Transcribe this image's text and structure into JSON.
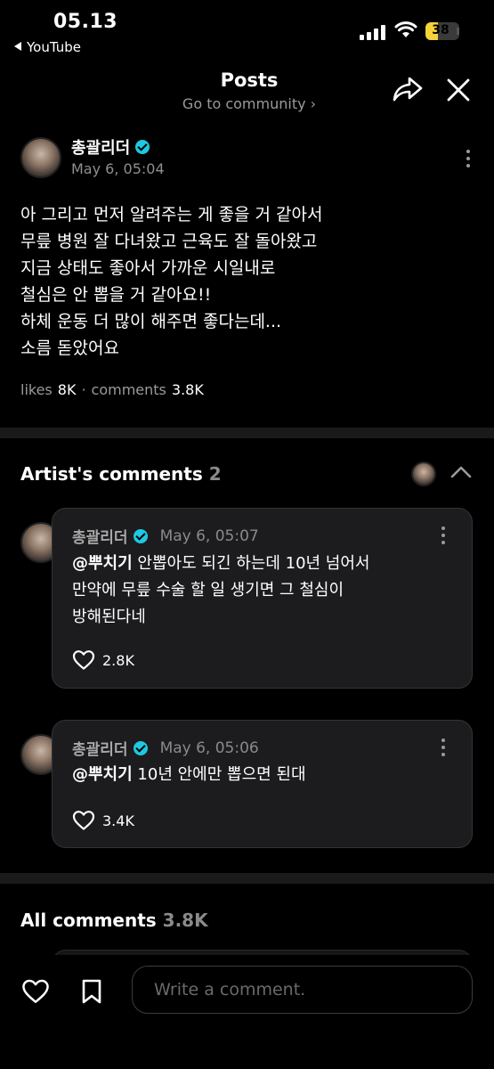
{
  "status_bar": {
    "time": "05.13",
    "back_app": "YouTube",
    "battery": "38",
    "battery_level": 0.38
  },
  "header": {
    "title": "Posts",
    "subtitle": "Go to community ›"
  },
  "post": {
    "author": "총괄리더",
    "date": "May 6, 05:04",
    "lines": [
      "아 그리고 먼저 알려주는 게 좋을 거 같아서",
      "무릎 병원 잘 다녀왔고 근육도 잘 돌아왔고",
      "지금 상태도 좋아서 가까운 시일내로",
      "철심은 안 뽑을 거 같아요!!",
      "하체 운동 더 많이 해주면 좋다는데...",
      "소름 돋았어요"
    ],
    "likes_label": "likes",
    "likes": "8K",
    "separator": "·",
    "comments_label": "comments",
    "comments": "3.8K"
  },
  "artist_comments": {
    "title": "Artist's comments",
    "count": "2",
    "items": [
      {
        "author": "총괄리더",
        "time": "May 6, 05:07",
        "mention": "@뿌치기",
        "lines": [
          "안뽑아도 되긴 하는데 10년 넘어서",
          "만약에 무릎 수술 할 일 생기면 그 철심이",
          "방해된다네"
        ],
        "likes": "2.8K"
      },
      {
        "author": "총괄리더",
        "time": "May 6, 05:06",
        "mention": "@뿌치기",
        "lines": [
          "10년 안에만 뽑으면 된대"
        ],
        "likes": "3.4K"
      }
    ]
  },
  "all_comments": {
    "title": "All comments",
    "count": "3.8K"
  },
  "bottom_bar": {
    "placeholder": "Write a comment."
  },
  "icons": {
    "back": "back-triangle-icon",
    "signal": "cellular-signal-icon",
    "wifi": "wifi-icon",
    "battery": "battery-icon",
    "share": "share-icon",
    "close": "close-icon",
    "more": "more-vertical-icon",
    "verified": "verified-badge-icon",
    "collapse": "chevron-up-icon",
    "like": "heart-icon",
    "bookmark": "bookmark-icon"
  },
  "colors": {
    "background": "#000000",
    "verified": "#1ec8e0",
    "bubble": "#1c1c1e",
    "muted_text": "#9a9a9a",
    "battery": "#f5d23a"
  }
}
